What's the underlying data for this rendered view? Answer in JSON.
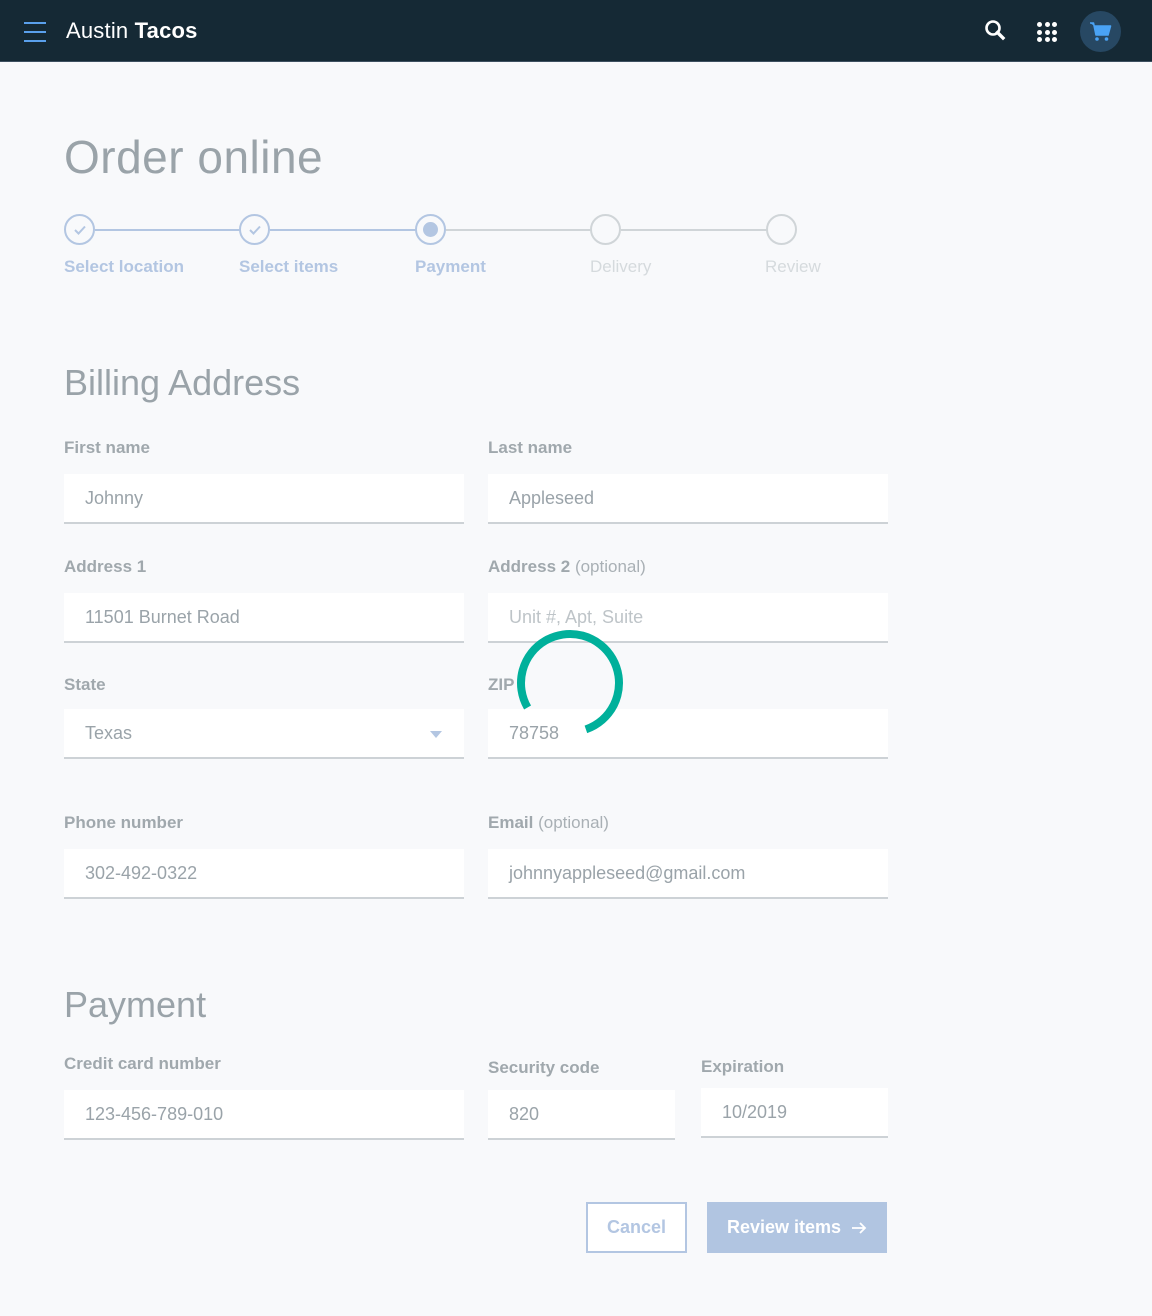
{
  "header": {
    "brand_light": "Austin",
    "brand_bold": "Tacos",
    "icons": [
      "menu-icon",
      "search-icon",
      "apps-grid-icon",
      "shopping-cart-icon"
    ],
    "colors": {
      "background": "#152935",
      "accent": "#5aa0ec",
      "cart_bg": "#274863"
    }
  },
  "page": {
    "title": "Order online"
  },
  "stepper": {
    "steps": [
      {
        "label": "Select location",
        "status": "complete"
      },
      {
        "label": "Select items",
        "status": "complete"
      },
      {
        "label": "Payment",
        "status": "current"
      },
      {
        "label": "Delivery",
        "status": "incomplete"
      },
      {
        "label": "Review",
        "status": "incomplete"
      }
    ],
    "colors": {
      "active": "#b3c6e2",
      "inactive": "#d0d5d8"
    }
  },
  "billing": {
    "title": "Billing Address",
    "first_name": {
      "label": "First name",
      "value": "Johnny"
    },
    "last_name": {
      "label": "Last name",
      "value": "Appleseed"
    },
    "address1": {
      "label": "Address 1",
      "value": "11501 Burnet Road"
    },
    "address2": {
      "label": "Address 2",
      "label_suffix": "(optional)",
      "value": "",
      "placeholder": "Unit #, Apt, Suite"
    },
    "state": {
      "label": "State",
      "value": "Texas"
    },
    "zip": {
      "label": "ZIP",
      "value": "78758"
    },
    "phone": {
      "label": "Phone number",
      "value": "302-492-0322"
    },
    "email": {
      "label": "Email",
      "label_suffix": "(optional)",
      "value": "johnnyappleseed@gmail.com"
    }
  },
  "payment": {
    "title": "Payment",
    "card_number": {
      "label": "Credit card number",
      "value": "123-456-789-010"
    },
    "security_code": {
      "label": "Security code",
      "value": "820"
    },
    "expiration": {
      "label": "Expiration",
      "value": "10/2019"
    }
  },
  "actions": {
    "cancel_label": "Cancel",
    "review_label": "Review items",
    "review_icon": "arrow-right-icon"
  },
  "loading": {
    "visible": true,
    "color": "#00b09b"
  }
}
